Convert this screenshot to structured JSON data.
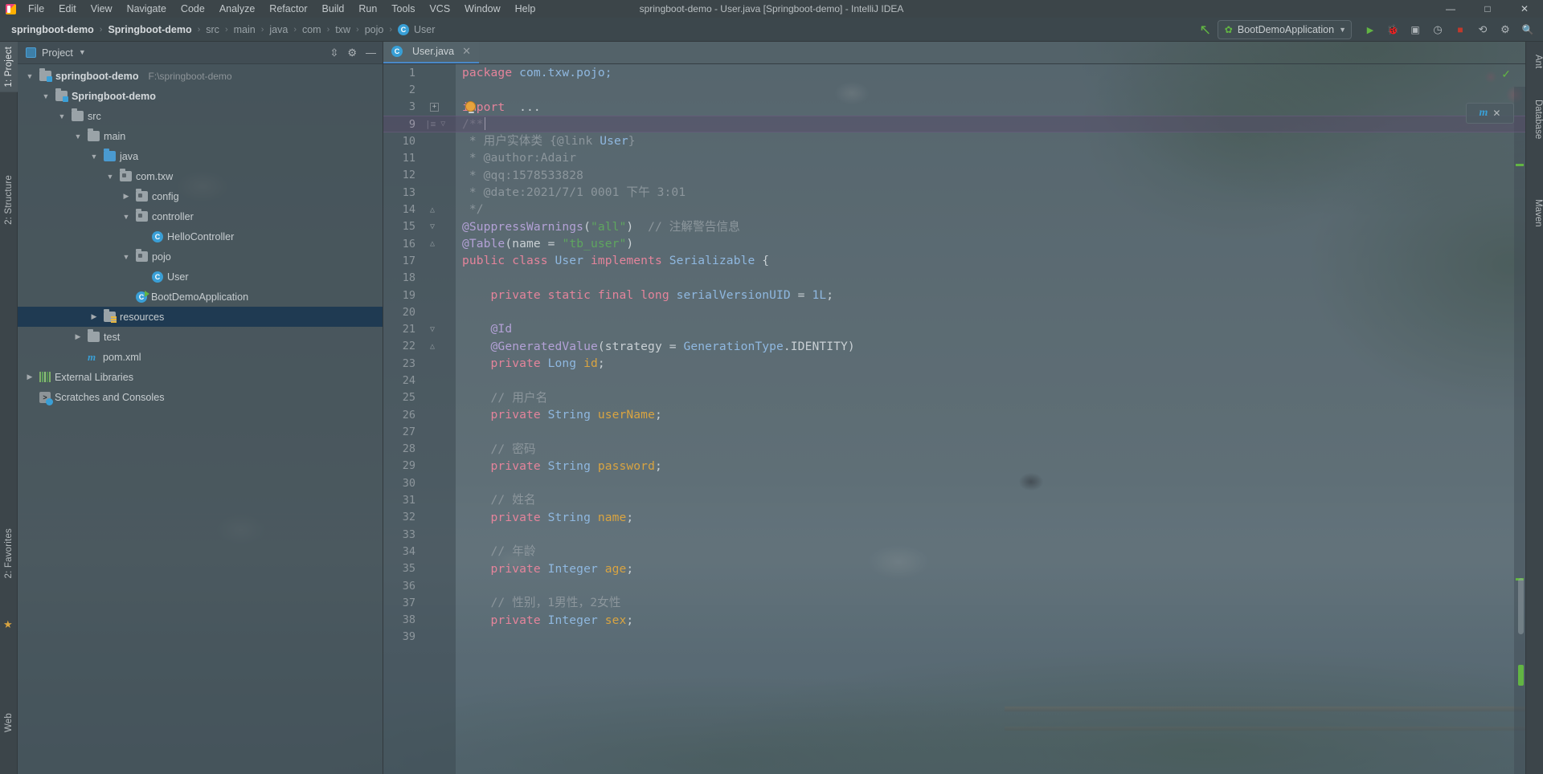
{
  "window": {
    "title": "springboot-demo - User.java [Springboot-demo] - IntelliJ IDEA",
    "minimize": "—",
    "maximize": "□",
    "close": "✕"
  },
  "menubar": {
    "items": [
      "File",
      "Edit",
      "View",
      "Navigate",
      "Code",
      "Analyze",
      "Refactor",
      "Build",
      "Run",
      "Tools",
      "VCS",
      "Window",
      "Help"
    ]
  },
  "breadcrumb": {
    "items": [
      "springboot-demo",
      "Springboot-demo",
      "src",
      "main",
      "java",
      "com",
      "txw",
      "pojo",
      "User"
    ],
    "separator": "›",
    "class_badge": "C"
  },
  "toolbar": {
    "run_config": "BootDemoApplication",
    "caret": "▼",
    "build_icon": "↖",
    "buttons": [
      {
        "name": "run-button",
        "glyph": "▶"
      },
      {
        "name": "debug-button",
        "glyph": "🐞"
      },
      {
        "name": "run-with-coverage-button",
        "glyph": "▣"
      },
      {
        "name": "profiler-button",
        "glyph": "◷"
      },
      {
        "name": "stop-button",
        "glyph": "■"
      },
      {
        "name": "update-project-button",
        "glyph": "⟲"
      },
      {
        "name": "settings-button",
        "glyph": "⚙"
      },
      {
        "name": "search-everywhere-button",
        "glyph": "🔍"
      }
    ]
  },
  "left_tool_strip": {
    "tabs": [
      {
        "label": "1: Project",
        "selected": true
      },
      {
        "label": "2: Structure",
        "selected": false
      },
      {
        "label": "2: Favorites",
        "selected": false
      },
      {
        "label": "Web",
        "selected": false
      }
    ],
    "star_glyph": "★"
  },
  "right_tool_strip": {
    "tabs": [
      {
        "label": "Ant"
      },
      {
        "label": "Database"
      },
      {
        "label": "Maven"
      }
    ]
  },
  "project_panel": {
    "title": "Project",
    "title_caret": "▼",
    "collapse_all_glyph": "⇳",
    "settings_glyph": "⚙",
    "hide_glyph": "—",
    "tree": [
      {
        "label": "springboot-demo",
        "path": "F:\\springboot-demo",
        "indent": 1,
        "twisty": "▼",
        "icon": "folder-module",
        "bold": true,
        "selected": false
      },
      {
        "label": "Springboot-demo",
        "path": "",
        "indent": 2,
        "twisty": "▼",
        "icon": "folder-module",
        "bold": true,
        "selected": false
      },
      {
        "label": "src",
        "path": "",
        "indent": 3,
        "twisty": "▼",
        "icon": "folder",
        "bold": false,
        "selected": false
      },
      {
        "label": "main",
        "path": "",
        "indent": 4,
        "twisty": "▼",
        "icon": "folder",
        "bold": false,
        "selected": false
      },
      {
        "label": "java",
        "path": "",
        "indent": 5,
        "twisty": "▼",
        "icon": "folder-source",
        "bold": false,
        "selected": false
      },
      {
        "label": "com.txw",
        "path": "",
        "indent": 6,
        "twisty": "▼",
        "icon": "folder-package",
        "bold": false,
        "selected": false
      },
      {
        "label": "config",
        "path": "",
        "indent": 7,
        "twisty": "▶",
        "icon": "folder-package",
        "bold": false,
        "selected": false
      },
      {
        "label": "controller",
        "path": "",
        "indent": 7,
        "twisty": "▼",
        "icon": "folder-package",
        "bold": false,
        "selected": false
      },
      {
        "label": "HelloController",
        "path": "",
        "indent": 8,
        "twisty": "",
        "icon": "class",
        "bold": false,
        "selected": false
      },
      {
        "label": "pojo",
        "path": "",
        "indent": 7,
        "twisty": "▼",
        "icon": "folder-package",
        "bold": false,
        "selected": false
      },
      {
        "label": "User",
        "path": "",
        "indent": 8,
        "twisty": "",
        "icon": "class",
        "bold": false,
        "selected": false
      },
      {
        "label": "BootDemoApplication",
        "path": "",
        "indent": 7,
        "twisty": "",
        "icon": "spring-app",
        "bold": false,
        "selected": false
      },
      {
        "label": "resources",
        "path": "",
        "indent": 5,
        "twisty": "▶",
        "icon": "folder-resources",
        "bold": false,
        "selected": true
      },
      {
        "label": "test",
        "path": "",
        "indent": 4,
        "twisty": "▶",
        "icon": "folder",
        "bold": false,
        "selected": false
      },
      {
        "label": "pom.xml",
        "path": "",
        "indent": 4,
        "twisty": "",
        "icon": "maven",
        "bold": false,
        "selected": false
      },
      {
        "label": "External Libraries",
        "path": "",
        "indent": 1,
        "twisty": "▶",
        "icon": "libraries",
        "bold": false,
        "selected": false
      },
      {
        "label": "Scratches and Consoles",
        "path": "",
        "indent": 1,
        "twisty": "",
        "icon": "scratches",
        "bold": false,
        "selected": false
      }
    ]
  },
  "editor": {
    "tab": {
      "label": "User.java",
      "badge": "C",
      "close": "✕"
    },
    "inspection_ok": "✓",
    "chip": {
      "icon": "m",
      "close": "✕"
    },
    "current_line": 9,
    "lines": [
      {
        "n": "1",
        "mark": "",
        "fold": "",
        "tokens": [
          {
            "t": "package ",
            "c": "kw"
          },
          {
            "t": "com.txw.pojo;",
            "c": "cls2"
          }
        ]
      },
      {
        "n": "2",
        "mark": "",
        "fold": "",
        "tokens": []
      },
      {
        "n": "3",
        "mark": "",
        "fold": "+",
        "tokens": [
          {
            "t": "import",
            "c": "kw"
          },
          {
            "t": "  ",
            "c": "plain"
          },
          {
            "t": "...",
            "c": "plain"
          }
        ]
      },
      {
        "n": "9",
        "mark": "|≡",
        "fold": "▽",
        "tokens": [
          {
            "t": "/**",
            "c": "cmt"
          }
        ]
      },
      {
        "n": "10",
        "mark": "",
        "fold": "",
        "tokens": [
          {
            "t": " * ",
            "c": "cmt"
          },
          {
            "t": "用户实体类 ",
            "c": "cmt"
          },
          {
            "t": "{@link ",
            "c": "cmt"
          },
          {
            "t": "User",
            "c": "cls2"
          },
          {
            "t": "}",
            "c": "cmt"
          }
        ]
      },
      {
        "n": "11",
        "mark": "",
        "fold": "",
        "tokens": [
          {
            "t": " * @author:Adair",
            "c": "cmt"
          }
        ]
      },
      {
        "n": "12",
        "mark": "",
        "fold": "",
        "tokens": [
          {
            "t": " * @qq:1578533828",
            "c": "cmt"
          }
        ]
      },
      {
        "n": "13",
        "mark": "",
        "fold": "",
        "tokens": [
          {
            "t": " * @date:2021/7/1 0001 下午 3:01",
            "c": "cmt"
          }
        ]
      },
      {
        "n": "14",
        "mark": "",
        "fold": "△",
        "tokens": [
          {
            "t": " */",
            "c": "cmt"
          }
        ]
      },
      {
        "n": "15",
        "mark": "",
        "fold": "▽",
        "tokens": [
          {
            "t": "@SuppressWarnings",
            "c": "ann"
          },
          {
            "t": "(",
            "c": "punc"
          },
          {
            "t": "\"all\"",
            "c": "str"
          },
          {
            "t": ")",
            "c": "punc"
          },
          {
            "t": "  ",
            "c": "plain"
          },
          {
            "t": "// 注解警告信息",
            "c": "cmt"
          }
        ]
      },
      {
        "n": "16",
        "mark": "",
        "fold": "△",
        "tokens": [
          {
            "t": "@Table",
            "c": "ann"
          },
          {
            "t": "(",
            "c": "punc"
          },
          {
            "t": "name = ",
            "c": "plain"
          },
          {
            "t": "\"tb_user\"",
            "c": "str"
          },
          {
            "t": ")",
            "c": "punc"
          }
        ]
      },
      {
        "n": "17",
        "mark": "",
        "fold": "",
        "tokens": [
          {
            "t": "public class ",
            "c": "kw"
          },
          {
            "t": "User",
            "c": "cls2"
          },
          {
            "t": " implements ",
            "c": "kw"
          },
          {
            "t": "Serializable",
            "c": "cls2"
          },
          {
            "t": " {",
            "c": "punc"
          }
        ]
      },
      {
        "n": "18",
        "mark": "",
        "fold": "",
        "tokens": []
      },
      {
        "n": "19",
        "mark": "",
        "fold": "",
        "tokens": [
          {
            "t": "    private static final long ",
            "c": "kw"
          },
          {
            "t": "serialVersionUID",
            "c": "cls2"
          },
          {
            "t": " = ",
            "c": "punc"
          },
          {
            "t": "1L",
            "c": "num"
          },
          {
            "t": ";",
            "c": "punc"
          }
        ]
      },
      {
        "n": "20",
        "mark": "",
        "fold": "",
        "tokens": []
      },
      {
        "n": "21",
        "mark": "",
        "fold": "▽",
        "tokens": [
          {
            "t": "    @Id",
            "c": "ann"
          }
        ]
      },
      {
        "n": "22",
        "mark": "",
        "fold": "△",
        "tokens": [
          {
            "t": "    @GeneratedValue",
            "c": "ann"
          },
          {
            "t": "(",
            "c": "punc"
          },
          {
            "t": "strategy = ",
            "c": "plain"
          },
          {
            "t": "GenerationType",
            "c": "cls2"
          },
          {
            "t": ".IDENTITY)",
            "c": "punc"
          }
        ]
      },
      {
        "n": "23",
        "mark": "",
        "fold": "",
        "tokens": [
          {
            "t": "    private ",
            "c": "kw"
          },
          {
            "t": "Long",
            "c": "cls2"
          },
          {
            "t": " ",
            "c": "plain"
          },
          {
            "t": "id",
            "c": "fld"
          },
          {
            "t": ";",
            "c": "punc"
          }
        ]
      },
      {
        "n": "24",
        "mark": "",
        "fold": "",
        "tokens": []
      },
      {
        "n": "25",
        "mark": "",
        "fold": "",
        "tokens": [
          {
            "t": "    // 用户名",
            "c": "cmt"
          }
        ]
      },
      {
        "n": "26",
        "mark": "",
        "fold": "",
        "tokens": [
          {
            "t": "    private ",
            "c": "kw"
          },
          {
            "t": "String",
            "c": "cls2"
          },
          {
            "t": " ",
            "c": "plain"
          },
          {
            "t": "userName",
            "c": "fld"
          },
          {
            "t": ";",
            "c": "punc"
          }
        ]
      },
      {
        "n": "27",
        "mark": "",
        "fold": "",
        "tokens": []
      },
      {
        "n": "28",
        "mark": "",
        "fold": "",
        "tokens": [
          {
            "t": "    // 密码",
            "c": "cmt"
          }
        ]
      },
      {
        "n": "29",
        "mark": "",
        "fold": "",
        "tokens": [
          {
            "t": "    private ",
            "c": "kw"
          },
          {
            "t": "String",
            "c": "cls2"
          },
          {
            "t": " ",
            "c": "plain"
          },
          {
            "t": "password",
            "c": "fld"
          },
          {
            "t": ";",
            "c": "punc"
          }
        ]
      },
      {
        "n": "30",
        "mark": "",
        "fold": "",
        "tokens": []
      },
      {
        "n": "31",
        "mark": "",
        "fold": "",
        "tokens": [
          {
            "t": "    // 姓名",
            "c": "cmt"
          }
        ]
      },
      {
        "n": "32",
        "mark": "",
        "fold": "",
        "tokens": [
          {
            "t": "    private ",
            "c": "kw"
          },
          {
            "t": "String",
            "c": "cls2"
          },
          {
            "t": " ",
            "c": "plain"
          },
          {
            "t": "name",
            "c": "fld"
          },
          {
            "t": ";",
            "c": "punc"
          }
        ]
      },
      {
        "n": "33",
        "mark": "",
        "fold": "",
        "tokens": []
      },
      {
        "n": "34",
        "mark": "",
        "fold": "",
        "tokens": [
          {
            "t": "    // 年龄",
            "c": "cmt"
          }
        ]
      },
      {
        "n": "35",
        "mark": "",
        "fold": "",
        "tokens": [
          {
            "t": "    private ",
            "c": "kw"
          },
          {
            "t": "Integer",
            "c": "cls2"
          },
          {
            "t": " ",
            "c": "plain"
          },
          {
            "t": "age",
            "c": "fld"
          },
          {
            "t": ";",
            "c": "punc"
          }
        ]
      },
      {
        "n": "36",
        "mark": "",
        "fold": "",
        "tokens": []
      },
      {
        "n": "37",
        "mark": "",
        "fold": "",
        "tokens": [
          {
            "t": "    // 性别，1男性，2女性",
            "c": "cmt"
          }
        ]
      },
      {
        "n": "38",
        "mark": "",
        "fold": "",
        "tokens": [
          {
            "t": "    private ",
            "c": "kw"
          },
          {
            "t": "Integer",
            "c": "cls2"
          },
          {
            "t": " ",
            "c": "plain"
          },
          {
            "t": "sex",
            "c": "fld"
          },
          {
            "t": ";",
            "c": "punc"
          }
        ]
      },
      {
        "n": "39",
        "mark": "",
        "fold": "",
        "tokens": []
      }
    ]
  },
  "colors": {
    "accent_blue": "#4a88c7",
    "selection_blue": "#1f3a52",
    "keyword_pink": "#e4849b",
    "string_green": "#5fa65f",
    "annotation_purple": "#b3a1d6",
    "class_blue": "#8fb8e0",
    "field_gold": "#d9a441",
    "comment_grey": "#8c969c",
    "ok_green": "#62b543"
  }
}
